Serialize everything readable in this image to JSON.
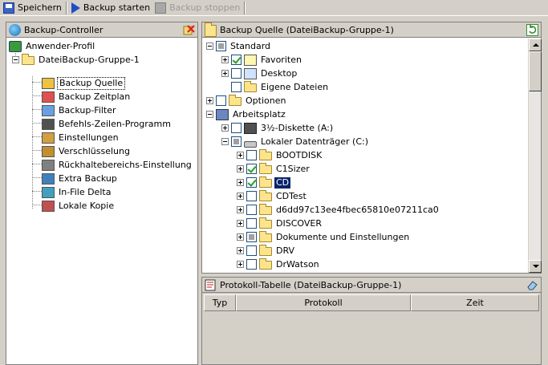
{
  "toolbar": {
    "save_label": "Speichern",
    "start_label": "Backup starten",
    "stop_label": "Backup stoppen"
  },
  "left_panel": {
    "title": "Backup-Controller",
    "profile_label": "Anwender-Profil",
    "group_label": "DateiBackup-Gruppe-1",
    "items": [
      {
        "label": "Backup Quelle",
        "icon": "backup-source-icon",
        "selected": true
      },
      {
        "label": "Backup Zeitplan",
        "icon": "clock-icon"
      },
      {
        "label": "Backup-Filter",
        "icon": "filter-icon"
      },
      {
        "label": "Befehls-Zeilen-Programm",
        "icon": "command-icon"
      },
      {
        "label": "Einstellungen",
        "icon": "settings-icon"
      },
      {
        "label": "Verschlüsselung",
        "icon": "lock-icon"
      },
      {
        "label": "Rückhaltebereichs-Einstellung",
        "icon": "trash-icon"
      },
      {
        "label": "Extra Backup",
        "icon": "disk-icon"
      },
      {
        "label": "In-File Delta",
        "icon": "delta-icon"
      },
      {
        "label": "Lokale Kopie",
        "icon": "copy-icon"
      }
    ]
  },
  "source_panel": {
    "title": "Backup Quelle (DateiBackup-Gruppe-1)",
    "tree": {
      "standard": "Standard",
      "favoriten": "Favoriten",
      "desktop": "Desktop",
      "eigene": "Eigene Dateien",
      "optionen": "Optionen",
      "arbeitsplatz": "Arbeitsplatz",
      "diskette": "3½-Diskette (A:)",
      "lokal": "Lokaler Datenträger (C:)",
      "folders": [
        "BOOTDISK",
        "C1Sizer",
        "CD",
        "CDTest",
        "d6dd97c13ee4fbec65810e07211ca0",
        "DISCOVER",
        "Dokumente und Einstellungen",
        "DRV",
        "DrWatson"
      ]
    }
  },
  "log_panel": {
    "title": "Protokoll-Tabelle (DateiBackup-Gruppe-1)",
    "columns": [
      "Typ",
      "Protokoll",
      "Zeit"
    ]
  }
}
